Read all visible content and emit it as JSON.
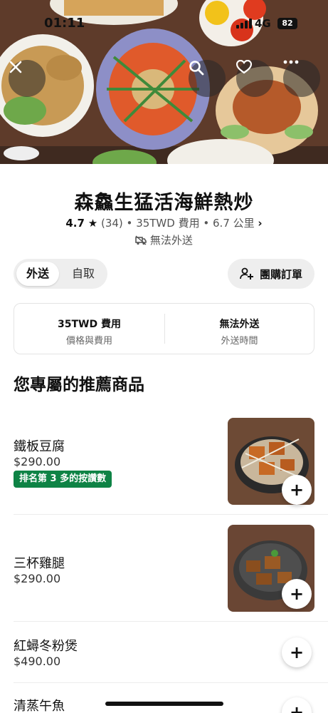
{
  "status": {
    "time": "01:11",
    "network": "4G",
    "battery": "82"
  },
  "store": {
    "name": "森鱻生猛活海鮮熱炒",
    "rating": "4.7",
    "reviews": "(34)",
    "fee": "35TWD 費用",
    "distance": "6.7 公里",
    "delivery_status": "無法外送"
  },
  "mode_toggle": {
    "delivery": "外送",
    "pickup": "自取"
  },
  "group_order_label": "團購訂單",
  "fees": {
    "price_value": "35TWD 費用",
    "price_label": "價格與費用",
    "time_value": "無法外送",
    "time_label": "外送時間"
  },
  "section_title": "您專屬的推薦商品",
  "items": [
    {
      "name": "鐵板豆腐",
      "price": "$290.00",
      "badge": "排名第 3 多的按讚數"
    },
    {
      "name": "三杯雞腿",
      "price": "$290.00"
    },
    {
      "name": "紅蟳冬粉煲",
      "price": "$490.00"
    },
    {
      "name": "清蒸午魚"
    }
  ],
  "icons": [
    "close-icon",
    "search-icon",
    "heart-icon",
    "more-icon",
    "star-icon",
    "no-delivery-icon",
    "group-add-icon",
    "plus-icon"
  ]
}
